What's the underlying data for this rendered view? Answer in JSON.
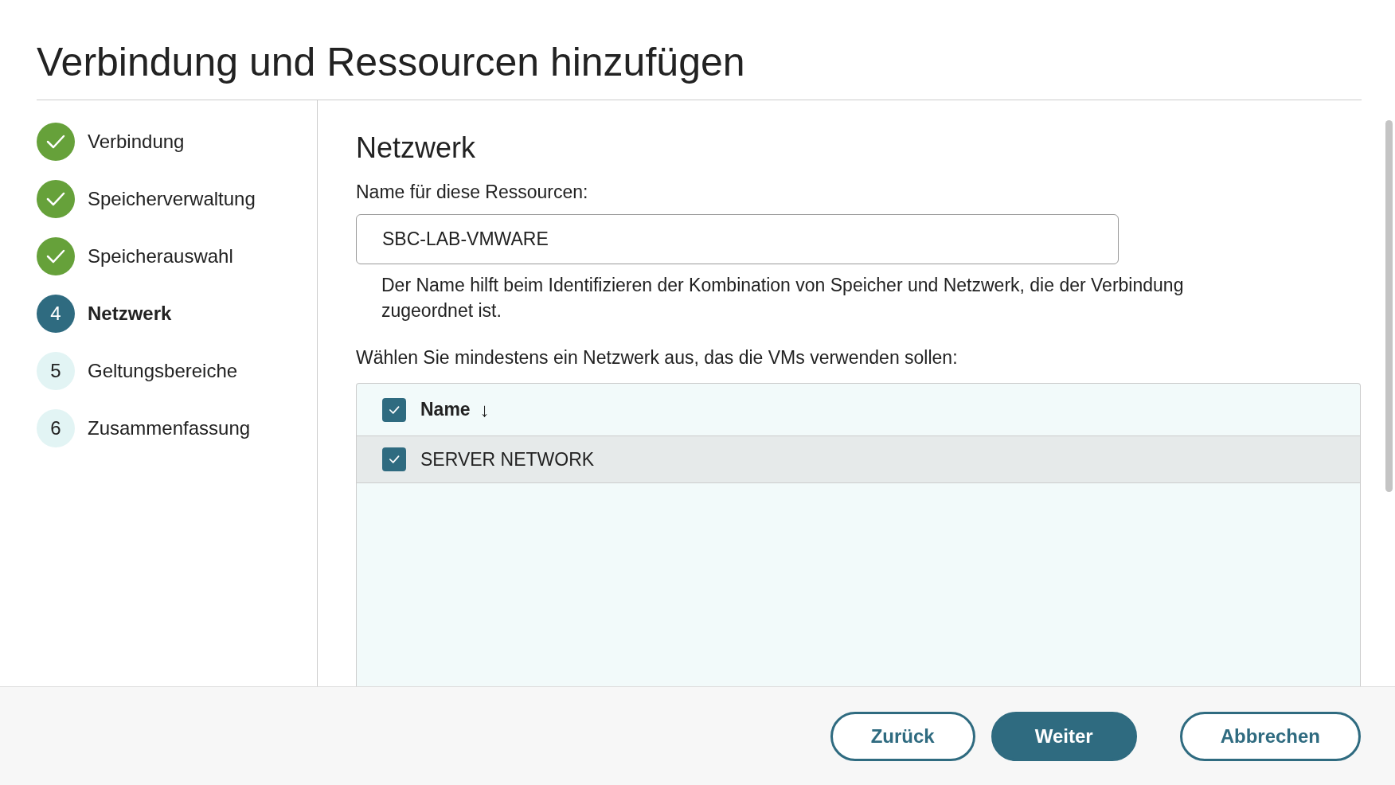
{
  "title": "Verbindung und Ressourcen hinzufügen",
  "steps": [
    {
      "label": "Verbindung",
      "kind": "done",
      "selected": false
    },
    {
      "label": "Speicherverwaltung",
      "kind": "done",
      "selected": false
    },
    {
      "label": "Speicherauswahl",
      "kind": "done",
      "selected": false
    },
    {
      "label": "Netzwerk",
      "number": "4",
      "kind": "numbered",
      "selected": true
    },
    {
      "label": "Geltungsbereiche",
      "number": "5",
      "kind": "numbered",
      "selected": false
    },
    {
      "label": "Zusammenfassung",
      "number": "6",
      "kind": "numbered",
      "selected": false
    }
  ],
  "section_title": "Netzwerk",
  "name_field": {
    "label": "Name für diese Ressourcen:",
    "value": "SBC-LAB-VMWARE",
    "help": "Der Name hilft beim Identifizieren der Kombination von Speicher und Netzwerk, die der Verbindung zugeordnet ist."
  },
  "network_prompt": "Wählen Sie mindestens ein Netzwerk aus, das die VMs verwenden sollen:",
  "table": {
    "header": {
      "label": "Name",
      "checked": true,
      "sort_icon": "↓"
    },
    "rows": [
      {
        "name": "SERVER NETWORK",
        "checked": true,
        "selected": true
      }
    ]
  },
  "buttons": [
    {
      "label": "Zurück",
      "kind": "secondary"
    },
    {
      "label": "Weiter",
      "kind": "primary"
    },
    {
      "label": "Abbrechen",
      "kind": "secondary"
    }
  ]
}
